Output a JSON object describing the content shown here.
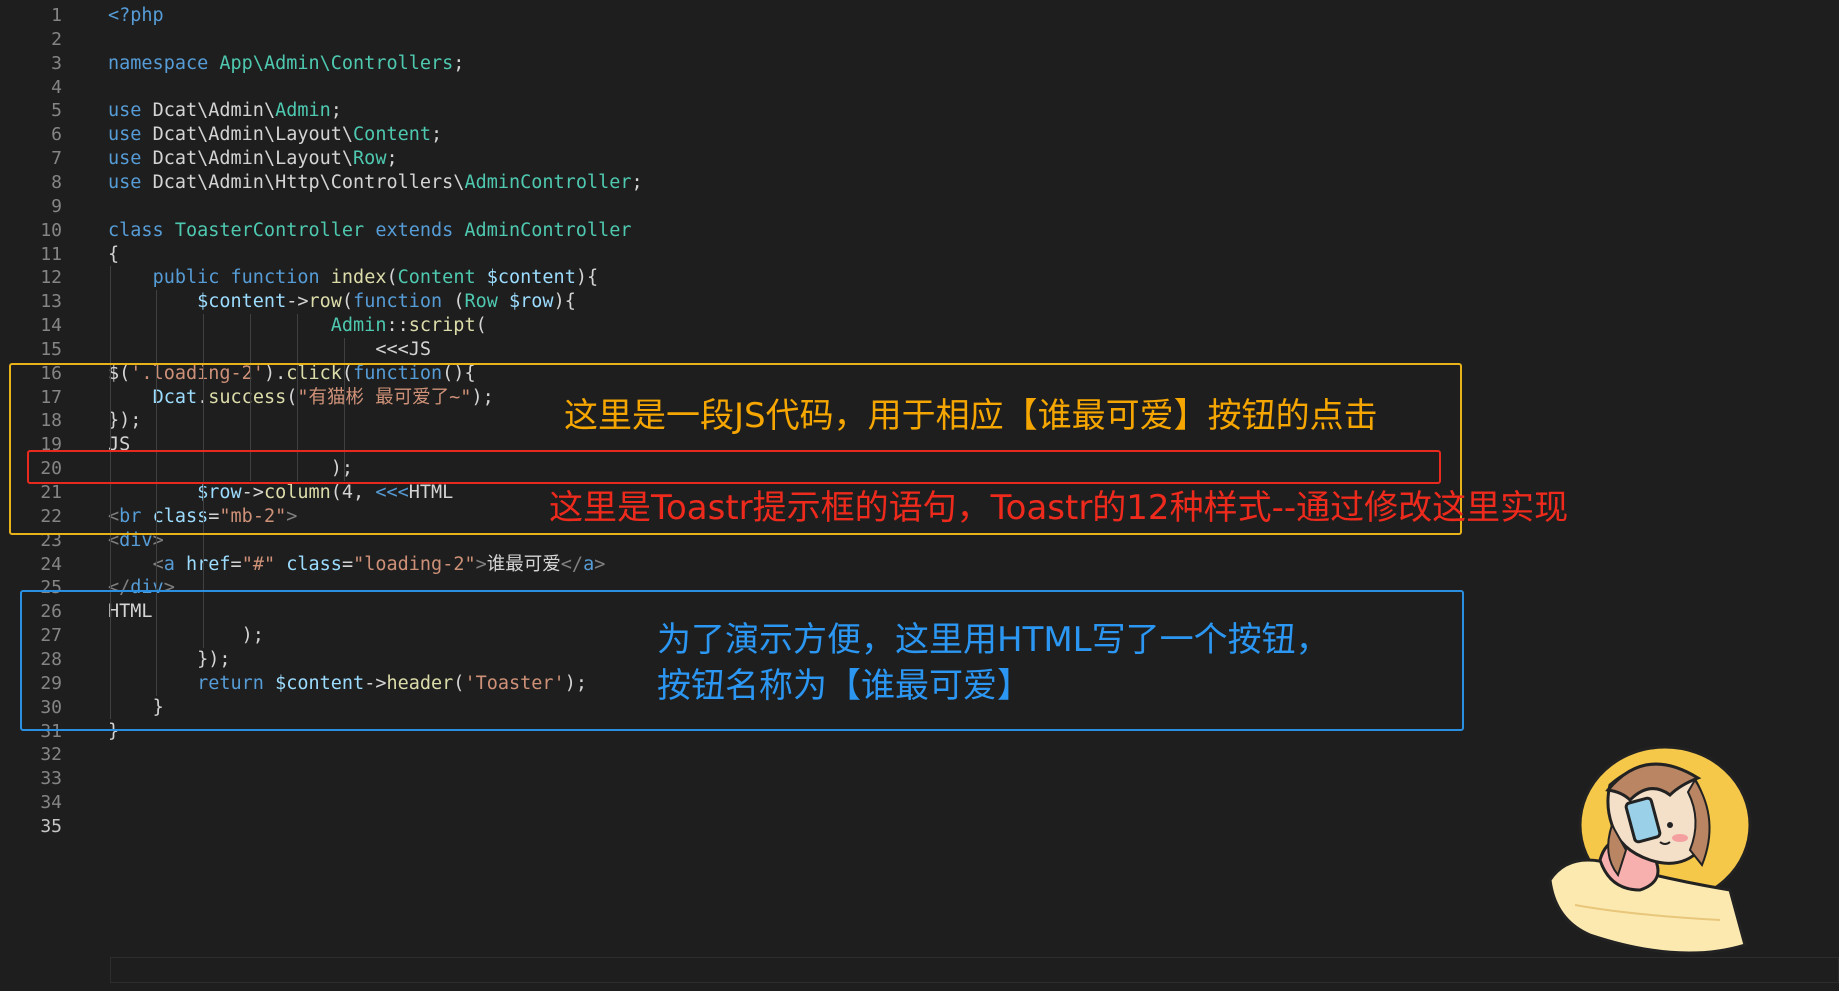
{
  "editor": {
    "current_line": "35",
    "lines": [
      {
        "no": "1",
        "tokens": [
          {
            "t": "<?php",
            "c": "kw"
          }
        ]
      },
      {
        "no": "2",
        "tokens": []
      },
      {
        "no": "3",
        "tokens": [
          {
            "t": "namespace ",
            "c": "kw"
          },
          {
            "t": "App\\Admin\\Controllers",
            "c": "type"
          },
          {
            "t": ";",
            "c": "plain"
          }
        ]
      },
      {
        "no": "4",
        "tokens": []
      },
      {
        "no": "5",
        "tokens": [
          {
            "t": "use ",
            "c": "kw"
          },
          {
            "t": "Dcat\\Admin\\",
            "c": "plain"
          },
          {
            "t": "Admin",
            "c": "type"
          },
          {
            "t": ";",
            "c": "plain"
          }
        ]
      },
      {
        "no": "6",
        "tokens": [
          {
            "t": "use ",
            "c": "kw"
          },
          {
            "t": "Dcat\\Admin\\Layout\\",
            "c": "plain"
          },
          {
            "t": "Content",
            "c": "type"
          },
          {
            "t": ";",
            "c": "plain"
          }
        ]
      },
      {
        "no": "7",
        "tokens": [
          {
            "t": "use ",
            "c": "kw"
          },
          {
            "t": "Dcat\\Admin\\Layout\\",
            "c": "plain"
          },
          {
            "t": "Row",
            "c": "type"
          },
          {
            "t": ";",
            "c": "plain"
          }
        ]
      },
      {
        "no": "8",
        "tokens": [
          {
            "t": "use ",
            "c": "kw"
          },
          {
            "t": "Dcat\\Admin\\Http\\Controllers\\",
            "c": "plain"
          },
          {
            "t": "AdminController",
            "c": "type"
          },
          {
            "t": ";",
            "c": "plain"
          }
        ]
      },
      {
        "no": "9",
        "tokens": []
      },
      {
        "no": "10",
        "tokens": [
          {
            "t": "class ",
            "c": "kw"
          },
          {
            "t": "ToasterController ",
            "c": "type"
          },
          {
            "t": "extends ",
            "c": "kw"
          },
          {
            "t": "AdminController",
            "c": "type"
          }
        ]
      },
      {
        "no": "11",
        "tokens": [
          {
            "t": "{",
            "c": "plain"
          }
        ]
      },
      {
        "no": "12",
        "tokens": [
          {
            "t": "    ",
            "c": "plain"
          },
          {
            "t": "public ",
            "c": "kw"
          },
          {
            "t": "function ",
            "c": "kw"
          },
          {
            "t": "index",
            "c": "fn"
          },
          {
            "t": "(",
            "c": "plain"
          },
          {
            "t": "Content ",
            "c": "type"
          },
          {
            "t": "$content",
            "c": "var"
          },
          {
            "t": "){",
            "c": "plain"
          }
        ]
      },
      {
        "no": "13",
        "tokens": [
          {
            "t": "        ",
            "c": "plain"
          },
          {
            "t": "$content",
            "c": "var"
          },
          {
            "t": "->",
            "c": "plain"
          },
          {
            "t": "row",
            "c": "fn"
          },
          {
            "t": "(",
            "c": "plain"
          },
          {
            "t": "function ",
            "c": "kw"
          },
          {
            "t": "(",
            "c": "plain"
          },
          {
            "t": "Row ",
            "c": "type"
          },
          {
            "t": "$row",
            "c": "var"
          },
          {
            "t": "){",
            "c": "plain"
          }
        ]
      },
      {
        "no": "14",
        "tokens": [
          {
            "t": "                    ",
            "c": "plain"
          },
          {
            "t": "Admin",
            "c": "type"
          },
          {
            "t": "::",
            "c": "plain"
          },
          {
            "t": "script",
            "c": "fn"
          },
          {
            "t": "(",
            "c": "plain"
          }
        ]
      },
      {
        "no": "15",
        "tokens": [
          {
            "t": "                        ",
            "c": "plain"
          },
          {
            "t": "<<<JS",
            "c": "plain"
          }
        ]
      },
      {
        "no": "16",
        "tokens": [
          {
            "t": "$(",
            "c": "plain"
          },
          {
            "t": "'.loading-2'",
            "c": "str"
          },
          {
            "t": ").",
            "c": "plain"
          },
          {
            "t": "click",
            "c": "fn"
          },
          {
            "t": "(",
            "c": "plain"
          },
          {
            "t": "function",
            "c": "kw"
          },
          {
            "t": "(){",
            "c": "plain"
          }
        ]
      },
      {
        "no": "17",
        "tokens": [
          {
            "t": "    ",
            "c": "plain"
          },
          {
            "t": "Dcat",
            "c": "var"
          },
          {
            "t": ".",
            "c": "plain"
          },
          {
            "t": "success",
            "c": "fn"
          },
          {
            "t": "(",
            "c": "plain"
          },
          {
            "t": "\"有猫彬 最可爱了~\"",
            "c": "str"
          },
          {
            "t": ");",
            "c": "plain"
          }
        ]
      },
      {
        "no": "18",
        "tokens": [
          {
            "t": "});",
            "c": "plain"
          }
        ]
      },
      {
        "no": "19",
        "tokens": [
          {
            "t": "JS",
            "c": "plain"
          }
        ]
      },
      {
        "no": "20",
        "tokens": [
          {
            "t": "                    ",
            "c": "plain"
          },
          {
            "t": ");",
            "c": "plain"
          }
        ]
      },
      {
        "no": "21",
        "tokens": [
          {
            "t": "        ",
            "c": "plain"
          },
          {
            "t": "$row",
            "c": "var"
          },
          {
            "t": "->",
            "c": "plain"
          },
          {
            "t": "column",
            "c": "fn"
          },
          {
            "t": "(4, ",
            "c": "plain"
          },
          {
            "t": "<<<",
            "c": "kw"
          },
          {
            "t": "HTML",
            "c": "plain"
          }
        ]
      },
      {
        "no": "22",
        "tokens": [
          {
            "t": "<",
            "c": "tag"
          },
          {
            "t": "br ",
            "c": "tagname"
          },
          {
            "t": "class",
            "c": "attr"
          },
          {
            "t": "=",
            "c": "plain"
          },
          {
            "t": "\"mb-2\"",
            "c": "str"
          },
          {
            "t": ">",
            "c": "tag"
          }
        ]
      },
      {
        "no": "23",
        "tokens": [
          {
            "t": "<",
            "c": "tag"
          },
          {
            "t": "div",
            "c": "tagname"
          },
          {
            "t": ">",
            "c": "tag"
          }
        ]
      },
      {
        "no": "24",
        "tokens": [
          {
            "t": "    ",
            "c": "plain"
          },
          {
            "t": "<",
            "c": "tag"
          },
          {
            "t": "a ",
            "c": "tagname"
          },
          {
            "t": "href",
            "c": "attr"
          },
          {
            "t": "=",
            "c": "plain"
          },
          {
            "t": "\"#\" ",
            "c": "str"
          },
          {
            "t": "class",
            "c": "attr"
          },
          {
            "t": "=",
            "c": "plain"
          },
          {
            "t": "\"loading-2\"",
            "c": "str"
          },
          {
            "t": ">",
            "c": "tag"
          },
          {
            "t": "谁最可爱",
            "c": "plain"
          },
          {
            "t": "</",
            "c": "tag"
          },
          {
            "t": "a",
            "c": "tagname"
          },
          {
            "t": ">",
            "c": "tag"
          }
        ]
      },
      {
        "no": "25",
        "tokens": [
          {
            "t": "</",
            "c": "tag"
          },
          {
            "t": "div",
            "c": "tagname"
          },
          {
            "t": ">",
            "c": "tag"
          }
        ]
      },
      {
        "no": "26",
        "tokens": [
          {
            "t": "HTML",
            "c": "plain"
          }
        ]
      },
      {
        "no": "27",
        "tokens": [
          {
            "t": "            ",
            "c": "plain"
          },
          {
            "t": ");",
            "c": "plain"
          }
        ]
      },
      {
        "no": "28",
        "tokens": [
          {
            "t": "        ",
            "c": "plain"
          },
          {
            "t": "});",
            "c": "plain"
          }
        ]
      },
      {
        "no": "29",
        "tokens": [
          {
            "t": "        ",
            "c": "plain"
          },
          {
            "t": "return ",
            "c": "kw"
          },
          {
            "t": "$content",
            "c": "var"
          },
          {
            "t": "->",
            "c": "plain"
          },
          {
            "t": "header",
            "c": "fn"
          },
          {
            "t": "(",
            "c": "plain"
          },
          {
            "t": "'Toaster'",
            "c": "str"
          },
          {
            "t": ");",
            "c": "plain"
          }
        ]
      },
      {
        "no": "30",
        "tokens": [
          {
            "t": "    ",
            "c": "plain"
          },
          {
            "t": "}",
            "c": "plain"
          }
        ]
      },
      {
        "no": "31",
        "tokens": [
          {
            "t": "}",
            "c": "plain"
          }
        ]
      },
      {
        "no": "32",
        "tokens": []
      },
      {
        "no": "33",
        "tokens": []
      },
      {
        "no": "34",
        "tokens": []
      },
      {
        "no": "35",
        "tokens": []
      }
    ]
  },
  "annotations": {
    "js_note": "这里是一段JS代码，用于相应【谁最可爱】按钮的点击",
    "toastr_note": "这里是Toastr提示框的语句，Toastr的12种样式--通过修改这里实现",
    "html_note_line1": "为了演示方便，这里用HTML写了一个按钮，",
    "html_note_line2": "按钮名称为【谁最可爱】"
  },
  "colors": {
    "background": "#1e1e1e",
    "js_box": "#e8b21a",
    "toastr_box": "#e82a1e",
    "html_box": "#2a8fe0",
    "js_note_text": "#f6a600",
    "toastr_note_text": "#ee2a1d",
    "html_note_text": "#2b97f2"
  },
  "decorations": {
    "mascot": "cartoon-girl-with-phone-sticker"
  }
}
